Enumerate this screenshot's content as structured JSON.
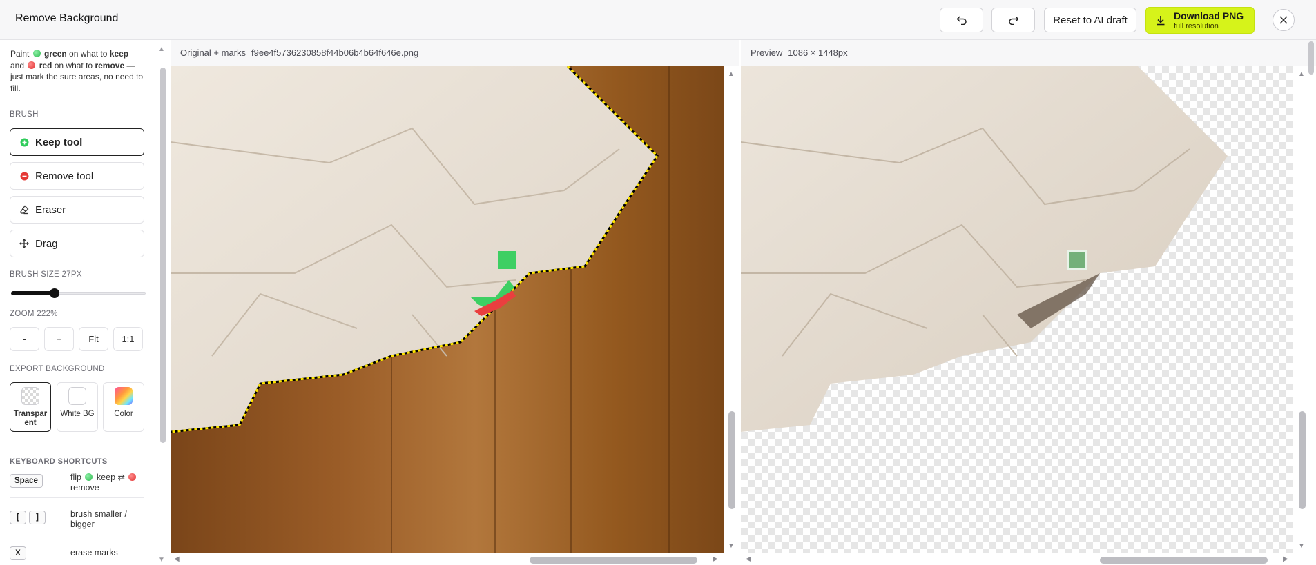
{
  "header": {
    "title": "Remove Background",
    "reset_label": "Reset to AI draft",
    "download_label": "Download PNG",
    "download_sub": "full resolution"
  },
  "sidebar": {
    "intro": {
      "p1": "Paint ",
      "green": "green",
      "p2": " on what to ",
      "keep": "keep",
      "p3": " and ",
      "red": "red",
      "p4": " on what to ",
      "remove": "remove",
      "p5": " — just mark the sure areas, no need to fill."
    },
    "brush_title": "BRUSH",
    "tools": [
      {
        "label": "Keep tool",
        "icon": "plus-circle-icon",
        "active": true
      },
      {
        "label": "Remove tool",
        "icon": "minus-circle-icon",
        "active": false
      },
      {
        "label": "Eraser",
        "icon": "eraser-icon",
        "active": false
      },
      {
        "label": "Drag",
        "icon": "move-icon",
        "active": false
      }
    ],
    "brush_size_label": "BRUSH SIZE 27PX",
    "brush_size_value": 27,
    "zoom_label": "ZOOM 222%",
    "zoom_buttons": [
      "-",
      "+",
      "Fit",
      "1:1"
    ],
    "export_bg_title": "EXPORT BACKGROUND",
    "export_options": [
      {
        "label": "Transparent",
        "active": true
      },
      {
        "label": "White BG",
        "active": false
      },
      {
        "label": "Color",
        "active": false
      }
    ],
    "shortcuts_title": "KEYBOARD SHORTCUTS",
    "shortcuts": [
      {
        "keys": [
          "Space"
        ],
        "desc_a": "flip ",
        "desc_b": " keep ⇄ ",
        "desc_c": " remove"
      },
      {
        "keys": [
          "[",
          "]"
        ],
        "desc": "brush smaller / bigger"
      },
      {
        "keys": [
          "X"
        ],
        "desc": "erase marks"
      }
    ]
  },
  "left_panel": {
    "label": "Original + marks",
    "filename": "f9ee4f5736230858f44b06b4b64f646e.png"
  },
  "right_panel": {
    "label": "Preview",
    "dimensions": "1086 × 1448px"
  },
  "colors": {
    "accent": "#d6f31a",
    "keep": "#2ecc5a",
    "remove": "#e53935"
  }
}
